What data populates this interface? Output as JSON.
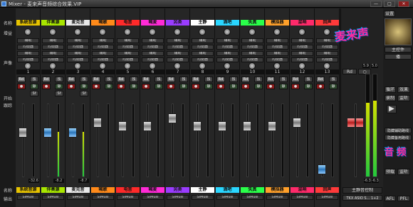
{
  "window": {
    "title": "Mixer - 麦来声音频综合效果.VIP",
    "minimize": "—",
    "maximize": "□",
    "close": "✕"
  },
  "row_labels": {
    "name": "名称",
    "gain": "增益",
    "send": "",
    "eq_left": "",
    "pan": "声像",
    "start": "开始",
    "follow": "跟踪",
    "input": "输入",
    "name_bottom": "名称",
    "output": "输出"
  },
  "channels": [
    {
      "name": "系统音源",
      "color": "#e8c400",
      "num": "1",
      "solo": "独",
      "mute": "静",
      "out": "SIMusi",
      "read": "-32.6",
      "level": 0.0,
      "fader": 0.62,
      "fader_color": "white",
      "meter": 0,
      "rd": "Rd",
      "tag": "Sf"
    },
    {
      "name": "伴奏源",
      "color": "#a8e600",
      "num": "2",
      "solo": "独",
      "mute": "静",
      "out": "SIMusi",
      "read": "-8.2",
      "level": 0.62,
      "fader": 0.62,
      "fader_color": "blue",
      "meter": 0.62,
      "rd": "Rd",
      "tag": "Sf"
    },
    {
      "name": "麦克音",
      "color": "#e8e8e8",
      "num": "3",
      "solo": "独",
      "mute": "静",
      "out": "SIMusi",
      "read": "-8.7",
      "level": 0.62,
      "fader": 0.62,
      "fader_color": "blue",
      "meter": 0.62,
      "rd": "Rd",
      "tag": "Sf"
    },
    {
      "name": "喊歌",
      "color": "#ff8a1a",
      "num": "4",
      "solo": "独",
      "mute": "静",
      "out": "SIMusi",
      "read": "",
      "level": 0,
      "fader": 0.78,
      "fader_color": "white",
      "meter": 0,
      "rd": "Rd",
      "tag": ""
    },
    {
      "name": "电音",
      "color": "#ff2a2a",
      "num": "5",
      "solo": "独",
      "mute": "静",
      "out": "SIMusi",
      "read": "",
      "level": 0,
      "fader": 0.72,
      "fader_color": "white",
      "meter": 0,
      "rd": "Rd",
      "tag": ""
    },
    {
      "name": "喊麦",
      "color": "#ff2ad6",
      "num": "6",
      "solo": "独",
      "mute": "静",
      "out": "SIMusi",
      "read": "",
      "level": 0,
      "fader": 0.72,
      "fader_color": "white",
      "meter": 0,
      "rd": "Rd",
      "tag": ""
    },
    {
      "name": "另类",
      "color": "#9a3cff",
      "num": "7",
      "solo": "独",
      "mute": "静",
      "out": "SIMusi",
      "read": "",
      "level": 0,
      "fader": 0.85,
      "fader_color": "white",
      "meter": 0,
      "rd": "Rd",
      "tag": ""
    },
    {
      "name": "主静",
      "color": "#ffffff",
      "num": "8",
      "solo": "独",
      "mute": "静",
      "out": "SIMusi",
      "read": "",
      "level": 0,
      "fader": 0.72,
      "fader_color": "white",
      "meter": 0,
      "rd": "Rd",
      "tag": ""
    },
    {
      "name": "酒吧",
      "color": "#2ad6ff",
      "num": "9",
      "solo": "独",
      "mute": "静",
      "out": "SIMusi",
      "read": "",
      "level": 0,
      "fader": 0.72,
      "fader_color": "white",
      "meter": 0,
      "rd": "Rd",
      "tag": ""
    },
    {
      "name": "失真",
      "color": "#2aff4a",
      "num": "10",
      "solo": "独",
      "mute": "静",
      "out": "SIMusi",
      "read": "",
      "level": 0,
      "fader": 0.72,
      "fader_color": "white",
      "meter": 0,
      "rd": "Rd",
      "tag": ""
    },
    {
      "name": "模拟器",
      "color": "#ffa02a",
      "num": "11",
      "solo": "独",
      "mute": "静",
      "out": "SIMusi",
      "read": "",
      "level": 0,
      "fader": 0.72,
      "fader_color": "white",
      "meter": 0,
      "rd": "Rd",
      "tag": ""
    },
    {
      "name": "混响",
      "color": "#ff2a6a",
      "num": "12",
      "solo": "独",
      "mute": "静",
      "out": "SIMusi",
      "read": "",
      "level": 0,
      "fader": 0.78,
      "fader_color": "white",
      "meter": 0,
      "rd": "Rd",
      "tag": ""
    },
    {
      "name": "回声",
      "color": "#ff3a3a",
      "num": "13",
      "solo": "独",
      "mute": "静",
      "out": "SIMusi",
      "read": "",
      "level": 0,
      "fader": 0.05,
      "fader_color": "blue",
      "meter": 0,
      "rd": "Rd",
      "tag": ""
    }
  ],
  "send_labels": {
    "aux": "辅助",
    "eq": "均衡器"
  },
  "master": {
    "label": "主静音控制",
    "name": "BAS",
    "out": "TKX ASIO S... 1+2",
    "read_l": "-6.3",
    "read_r": "-6.3",
    "top_l": "5.9",
    "top_r": "5.0",
    "level_l": 0.72,
    "level_r": 0.74,
    "fader": 0.78
  },
  "right_panel": {
    "settings": "设置",
    "spectrum": "频率",
    "master_send": "主控件",
    "play": "播",
    "loop": "循环",
    "effects": "效果",
    "rec_label": "录播",
    "record": "录制",
    "monitor": "监听",
    "arrow": "▶",
    "check1": "隐藏辅助路线",
    "check2": "隐藏备用路线",
    "bottom1": "预载",
    "bottom2": "监听",
    "afl": "AFL",
    "pfl": "PFL",
    "watermark_top": "麦来声",
    "watermark_right": "音 频"
  }
}
